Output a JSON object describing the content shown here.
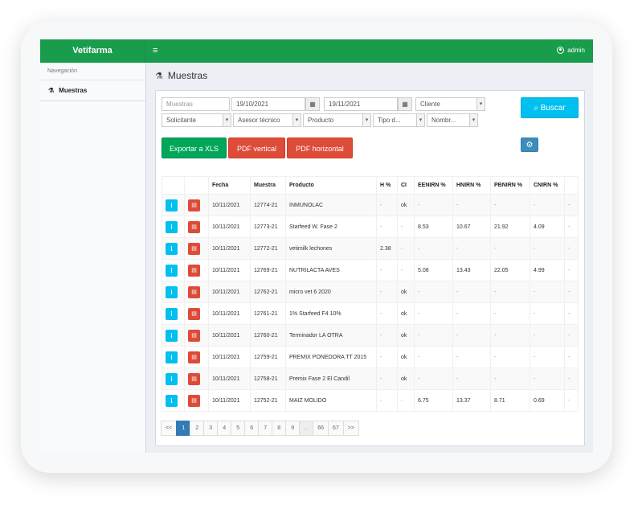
{
  "app": {
    "brand": "Vetifarma",
    "user": "admin"
  },
  "sidebar": {
    "heading": "Navegación",
    "items": [
      {
        "label": "Muestras"
      }
    ]
  },
  "page": {
    "title": "Muestras"
  },
  "filters": {
    "muestras_placeholder": "Muestras",
    "date_from": "19/10/2021",
    "date_to": "19/11/2021",
    "cliente": "Cliente",
    "solicitante": "Solicitante",
    "asesor": "Asesor técnico",
    "producto": "Producto",
    "tipo": "Tipo d...",
    "nombre": "Nombr..."
  },
  "buttons": {
    "search": "Buscar",
    "export_xls": "Exportar a XLS",
    "pdf_vertical": "PDF vertical",
    "pdf_horizontal": "PDF horizontal"
  },
  "table": {
    "headers": [
      "",
      "",
      "Fecha",
      "Muestra",
      "Producto",
      "H %",
      "CI",
      "EENIRN %",
      "HNIRN %",
      "PBNIRN %",
      "CNIRN %",
      ""
    ],
    "rows": [
      [
        "10/11/2021",
        "12774-21",
        "INMUNOLAC",
        "-",
        "ok",
        "-",
        "-",
        "-",
        "-",
        "-"
      ],
      [
        "10/11/2021",
        "12773-21",
        "Starfeed W. Fase 2",
        "-",
        "-",
        "8.53",
        "10.67",
        "21.92",
        "4.09",
        "-"
      ],
      [
        "10/11/2021",
        "12772-21",
        "vetimilk lechones",
        "2.38",
        "-",
        "-",
        "-",
        "-",
        "-",
        "-"
      ],
      [
        "10/11/2021",
        "12769-21",
        "NUTRILACTA AVES",
        "-",
        "-",
        "5.08",
        "13.43",
        "22.05",
        "4.99",
        "-"
      ],
      [
        "10/11/2021",
        "12762-21",
        "micro vet 6 2020",
        "-",
        "ok",
        "-",
        "-",
        "-",
        "-",
        "-"
      ],
      [
        "10/11/2021",
        "12761-21",
        "1% Starfeed F4 10%",
        "-",
        "ok",
        "-",
        "-",
        "-",
        "-",
        "-"
      ],
      [
        "10/11/2021",
        "12760-21",
        "Terminador LA OTRA",
        "-",
        "ok",
        "-",
        "-",
        "-",
        "-",
        "-"
      ],
      [
        "10/11/2021",
        "12759-21",
        "PREMIX PONEDORA TT 2015",
        "-",
        "ok",
        "-",
        "-",
        "-",
        "-",
        "-"
      ],
      [
        "10/11/2021",
        "12758-21",
        "Premix Fase 2 El Candil",
        "-",
        "ok",
        "-",
        "-",
        "-",
        "-",
        "-"
      ],
      [
        "10/11/2021",
        "12752-21",
        "MAIZ MOLIDO",
        "-",
        "-",
        "6.75",
        "13.37",
        "8.71",
        "0.69",
        "-"
      ]
    ]
  },
  "pagination": [
    "<<",
    "1",
    "2",
    "3",
    "4",
    "5",
    "6",
    "7",
    "8",
    "9",
    "...",
    "66",
    "67",
    ">>"
  ],
  "pagination_active": "1"
}
